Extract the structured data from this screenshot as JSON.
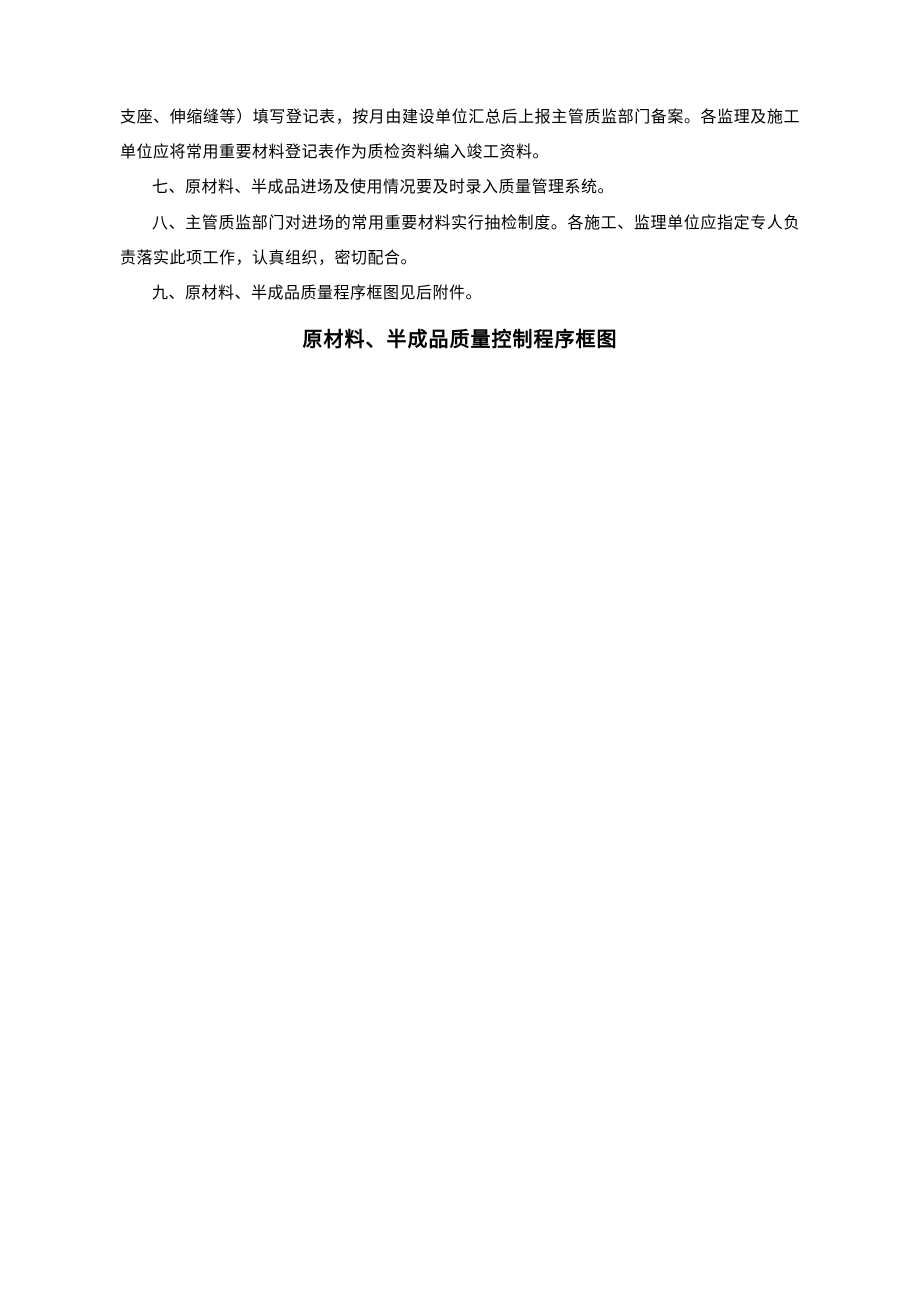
{
  "body": {
    "para1": "支座、伸缩缝等）填写登记表，按月由建设单位汇总后上报主管质监部门备案。各监理及施工单位应将常用重要材料登记表作为质检资料编入竣工资料。",
    "para2": "七、原材料、半成品进场及使用情况要及时录入质量管理系统。",
    "para3": "八、主管质监部门对进场的常用重要材料实行抽检制度。各施工、监理单位应指定专人负责落实此项工作，认真组织，密切配合。",
    "para4": "九、原材料、半成品质量程序框图见后附件。"
  },
  "title": "原材料、半成品质量控制程序框图"
}
